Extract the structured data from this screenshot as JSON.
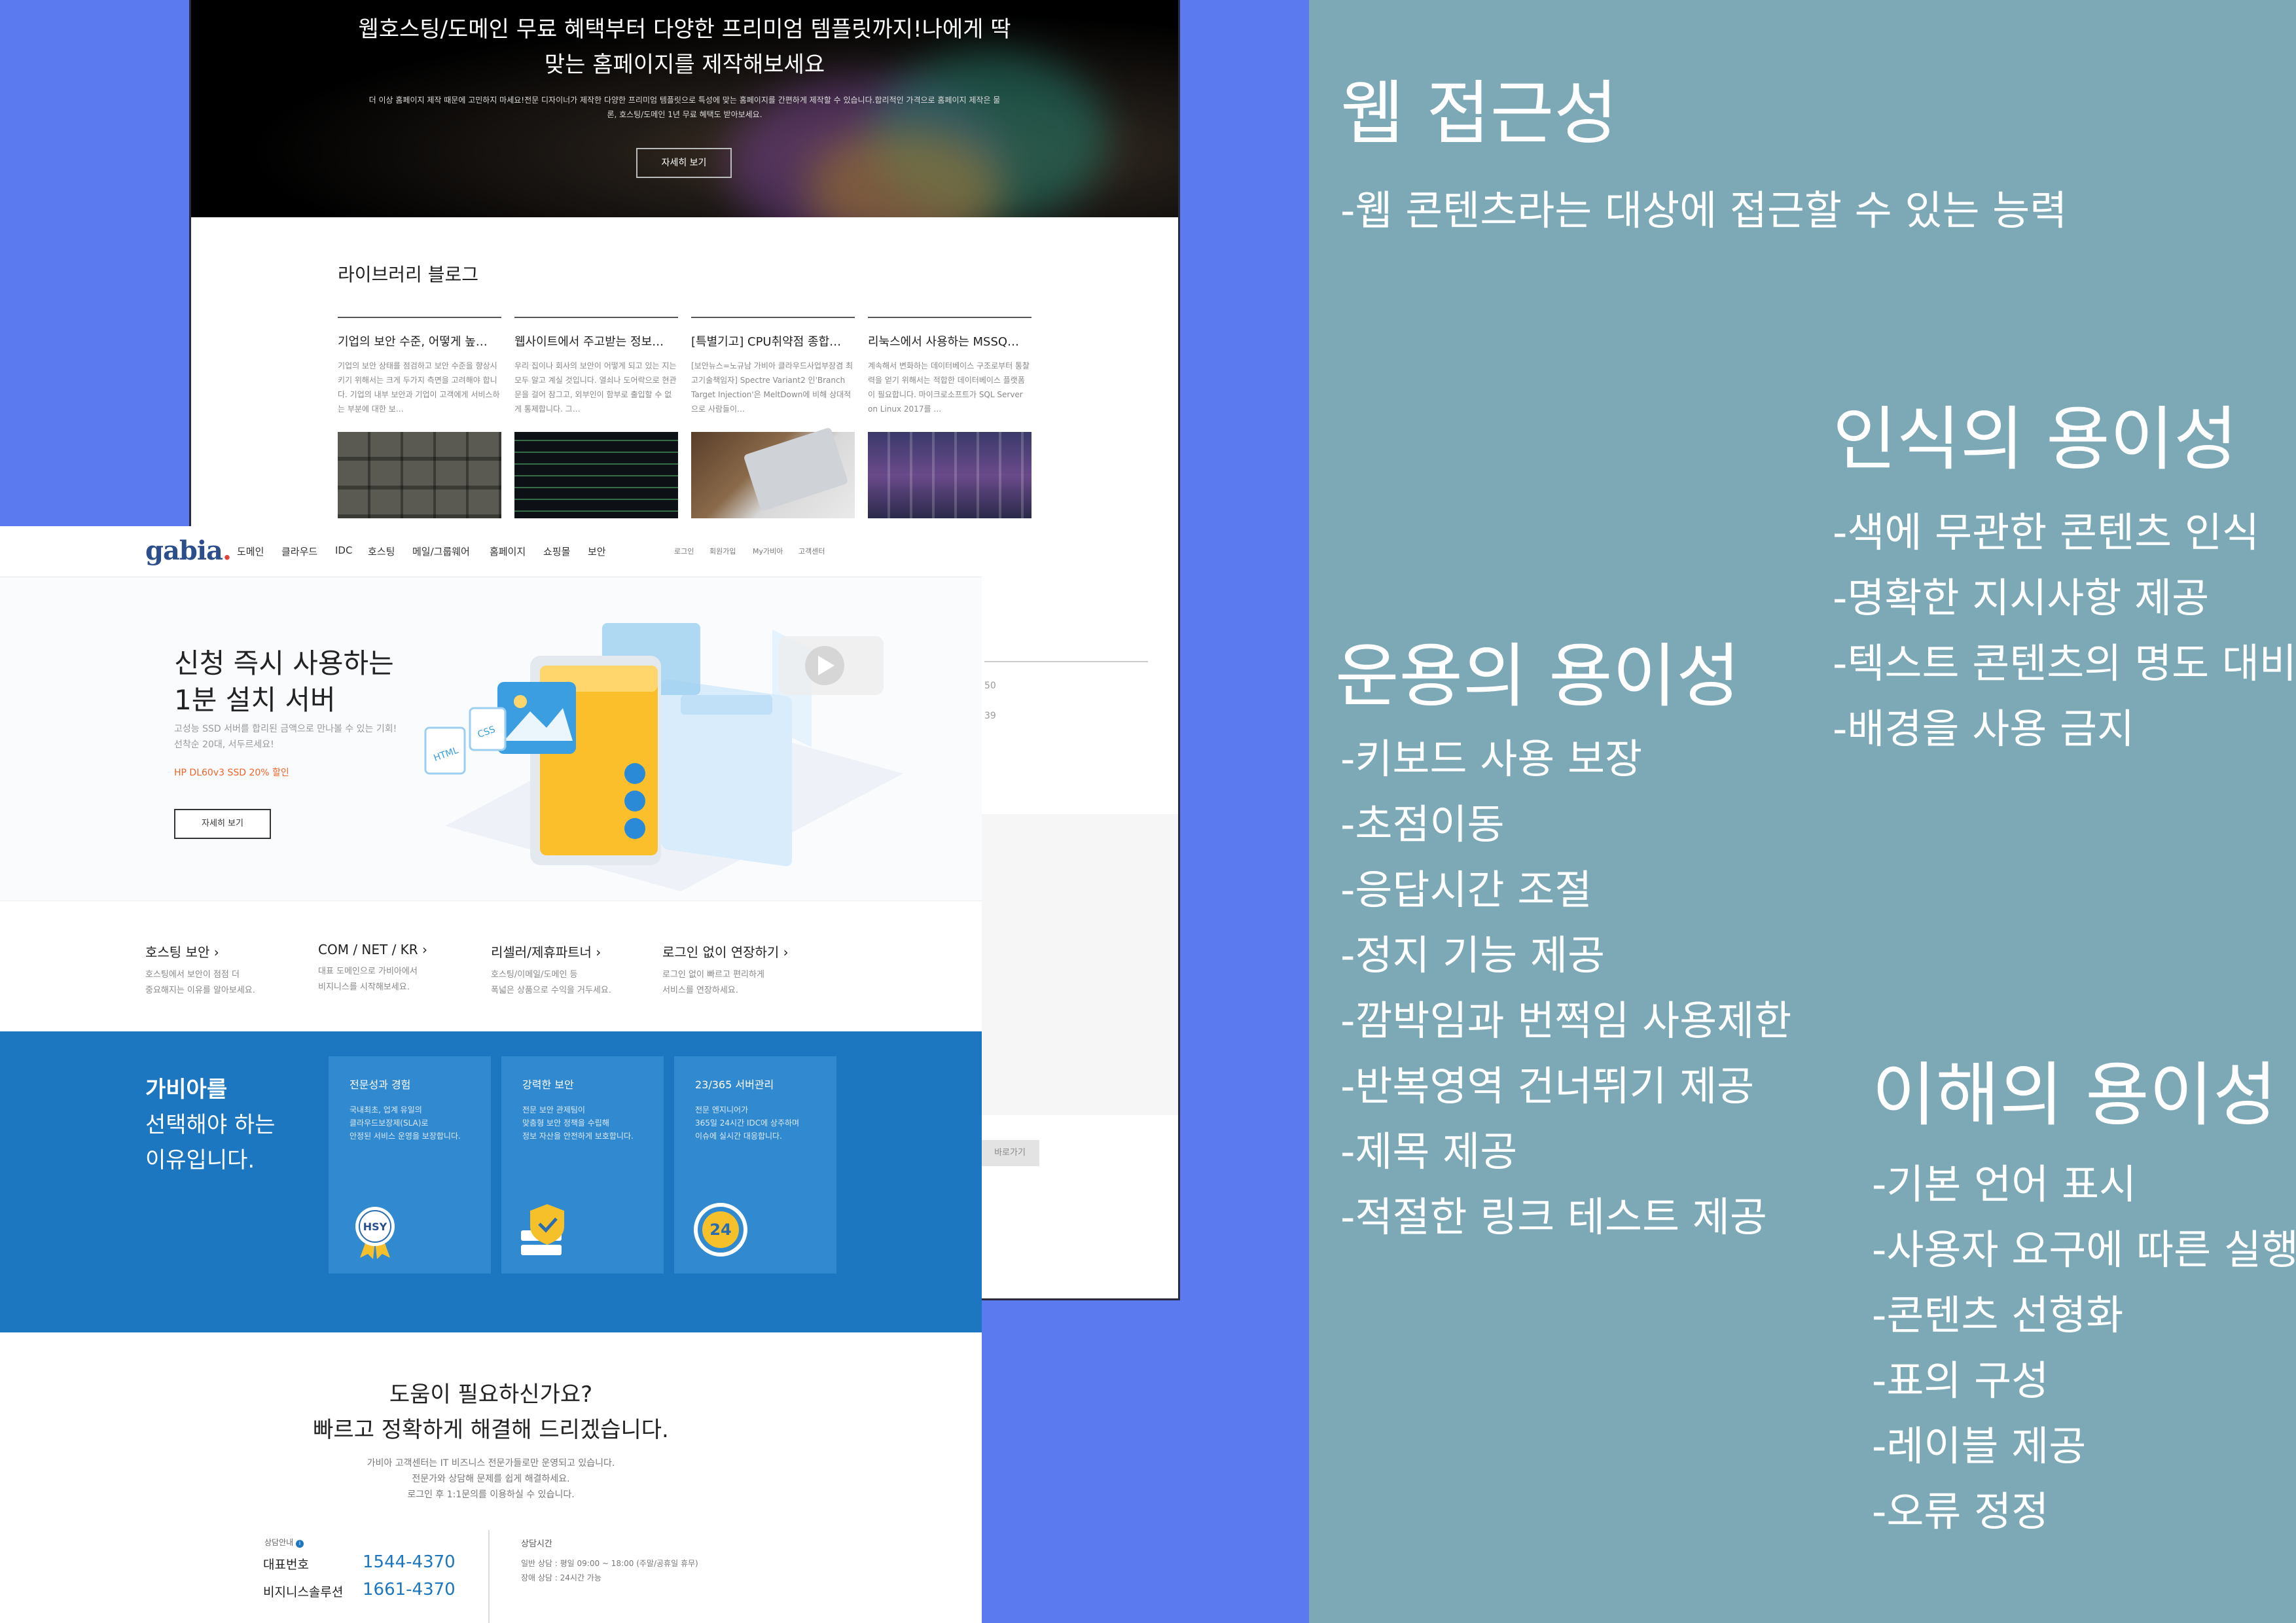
{
  "colors": {
    "page_bg": "#5b7af0",
    "panel_bg": "#7ca9b5",
    "gabia_blue": "#1c76c0",
    "promo_orange": "#f0642a"
  },
  "back_page": {
    "hero_title_line1": "웹호스팅/도메인 무료 혜택부터 다양한 프리미엄 템플릿까지!나에게 딱",
    "hero_title_line2": "맞는 홈페이지를 제작해보세요",
    "hero_desc_line1": "더 이상 홈페이지 제작 때문에 고민하지 마세요!전문 디자이너가 제작한 다양한 프리미엄 템플릿으로 특성에 맞는 홈페이지를 간편하게 제작할 수 있습니다.합리적인 가격으로 홈페이지 제작은 물",
    "hero_desc_line2": "론, 호스팅/도메인 1년 무료 혜택도 받아보세요.",
    "hero_button": "자세히 보기",
    "blog_heading": "라이브러리 블로그",
    "blog_posts": [
      {
        "title": "기업의 보안 수준, 어떻게 높…",
        "desc": "기업의 보안 상태를 점검하고 보안 수준을 향상시키기 위해서는 크게 두가지 측면을 고려해야 합니다. 기업의 내부 보안과 기업이 고객에게 서비스하는 부분에 대한 보…"
      },
      {
        "title": "웹사이트에서 주고받는 정보…",
        "desc": "우리 집이나 회사의 보안이 어떻게 되고 있는 지는 모두 알고 계실 것입니다. 열쇠나 도어락으로 현관문을 걸어 잠그고, 외부인이 함부로 출입할 수 없게 통제합니다. 그…"
      },
      {
        "title": "[특별기고] CPU취약점 종합…",
        "desc": "[보안뉴스=노규남 가비아 클라우드사업부장겸 최고기술책임자] Spectre Variant2 인'Branch Target Injection'은 MeltDown에 비해 상대적으로 사람들이…"
      },
      {
        "title": "리눅스에서 사용하는 MSSQ…",
        "desc": "계속해서 변화하는 데이터베이스 구조로부터 통찰력을 얻기 위해서는 적합한 데이터베이스 플랫폼이 필요합니다. 마이크로소프트가 SQL Server on Linux 2017를 …"
      }
    ],
    "side_nums": [
      "50",
      "39"
    ],
    "more_button": "바로가기"
  },
  "front_page": {
    "logo": "gabia",
    "nav": [
      "도메인",
      "클라우드",
      "IDC",
      "호스팅",
      "메일/그룹웨어",
      "홈페이지",
      "쇼핑몰",
      "보안"
    ],
    "util": [
      "로그인",
      "회원가입",
      "My가비아",
      "고객센터"
    ],
    "banner_title_line1": "신청 즉시 사용하는",
    "banner_title_line2": "1분 설치 서버",
    "banner_desc_line1": "고성능 SSD 서버를 합리된 금액으로 만나볼 수 있는 기회!",
    "banner_desc_line2": "선착순 20대, 서두르세요!",
    "banner_promo": "HP DL60v3 SSD 20% 할인",
    "banner_button": "자세히 보기",
    "illust_html": "HTML",
    "illust_css": "CSS",
    "quick_links": [
      {
        "title": "호스팅 보안 ›",
        "desc1": "호스팅에서 보안이 점점 더",
        "desc2": "중요해지는 이유를 알아보세요."
      },
      {
        "title": "COM / NET / KR ›",
        "desc1": "대표 도메인으로 가비아에서",
        "desc2": "비지니스를 시작해보세요."
      },
      {
        "title": "리셀러/제휴파트너 ›",
        "desc1": "호스팅/이메일/도메인 등",
        "desc2": "폭넓은 상품으로 수익을 거두세요."
      },
      {
        "title": "로그인 없이 연장하기 ›",
        "desc1": "로그인 없이 빠르고 편리하게",
        "desc2": "서비스를 연장하세요."
      }
    ],
    "why_title_line1": "가비아를",
    "why_title_line2": "선택해야 하는",
    "why_title_line3": "이유입니다.",
    "why_cards": [
      {
        "title": "전문성과 경험",
        "d1": "국내최초, 업계 유일의",
        "d2": "클라우드보장제(SLA)로",
        "d3": "안정된 서비스 운영을 보장합니다.",
        "badge": "HSY"
      },
      {
        "title": "강력한 보안",
        "d1": "전문 보안 관제팀이",
        "d2": "맞춤형 보안 정책을 수립해",
        "d3": "정보 자산을 안전하게 보호합니다."
      },
      {
        "title": "23/365 서버관리",
        "d1": "전문 엔지니어가",
        "d2": "365일 24시간 IDC에 상주하며",
        "d3": "이슈에 실시간 대응합니다.",
        "badge": "24"
      }
    ],
    "help_title_line1": "도움이 필요하신가요?",
    "help_title_line2": "빠르고 정확하게 해결해 드리겠습니다.",
    "help_desc_line1": "가비아 고객센터는 IT 비즈니스 전문가들로만 운영되고 있습니다.",
    "help_desc_line2": "전문가와 상담해 문제를 쉽게 해결하세요.",
    "help_desc_line3": "로그인 후 1:1문의를 이용하실 수 있습니다.",
    "contact_label": "상담안내",
    "phone_rows": [
      {
        "label": "대표번호",
        "number": "1544-4370"
      },
      {
        "label": "비지니스솔루션",
        "number": "1661-4370"
      }
    ],
    "hours_label": "상담시간",
    "hours_line1": "일반 상담 : 평일 09:00 ~ 18:00 (주말/공휴일 휴무)",
    "hours_line2": "장애 상담 : 24시간 가능"
  },
  "accessibility": {
    "web": {
      "title": "웹 접근성",
      "items": [
        "-웹 콘텐츠라는 대상에 접근할 수 있는 능력"
      ]
    },
    "perceivable": {
      "title": "인식의 용이성",
      "items": [
        "-색에 무관한 콘텐츠 인식",
        "-명확한 지시사항 제공",
        "-텍스트 콘텐츠의 명도 대비",
        "-배경을 사용 금지"
      ]
    },
    "operable": {
      "title": "운용의 용이성",
      "items": [
        "-키보드 사용 보장",
        "-초점이동",
        "-응답시간 조절",
        "-정지 기능 제공",
        "-깜박임과 번쩍임 사용제한",
        "-반복영역 건너뛰기 제공",
        "-제목 제공",
        "-적절한 링크 테스트 제공"
      ]
    },
    "understandable": {
      "title": "이해의 용이성",
      "items": [
        "-기본 언어 표시",
        "-사용자 요구에 따른 실행",
        "-콘텐츠 선형화",
        "-표의 구성",
        "-레이블 제공",
        "-오류 정정"
      ]
    }
  }
}
